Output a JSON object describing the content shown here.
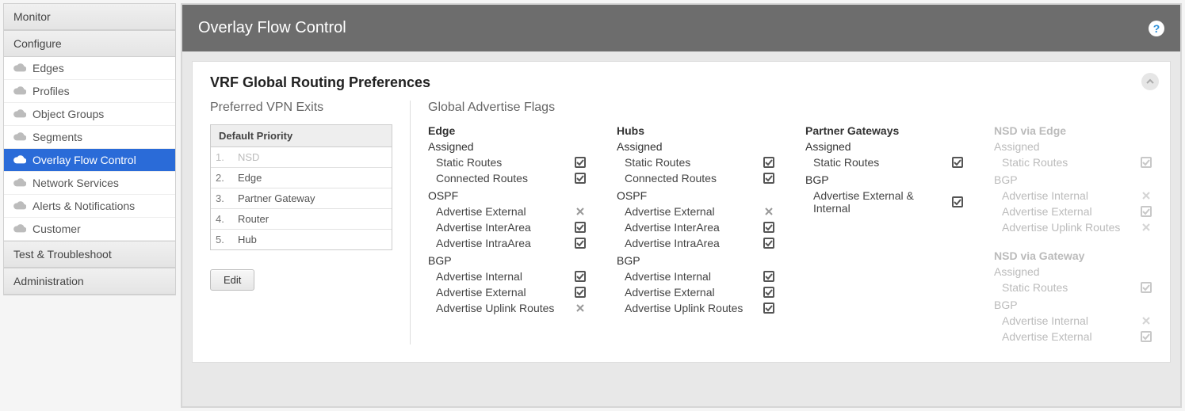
{
  "sidebar": {
    "sections": {
      "monitor": "Monitor",
      "configure": "Configure",
      "test": "Test & Troubleshoot",
      "admin": "Administration"
    },
    "configure_items": [
      {
        "label": "Edges",
        "active": false
      },
      {
        "label": "Profiles",
        "active": false
      },
      {
        "label": "Object Groups",
        "active": false
      },
      {
        "label": "Segments",
        "active": false
      },
      {
        "label": "Overlay Flow Control",
        "active": true
      },
      {
        "label": "Network Services",
        "active": false
      },
      {
        "label": "Alerts & Notifications",
        "active": false
      },
      {
        "label": "Customer",
        "active": false
      }
    ]
  },
  "header": {
    "title": "Overlay Flow Control"
  },
  "panel": {
    "title": "VRF Global Routing Preferences",
    "vpn_exits": {
      "title": "Preferred VPN Exits",
      "table_header": "Default Priority",
      "rows": [
        {
          "num": "1.",
          "name": "NSD",
          "disabled": true
        },
        {
          "num": "2.",
          "name": "Edge",
          "disabled": false
        },
        {
          "num": "3.",
          "name": "Partner Gateway",
          "disabled": false
        },
        {
          "num": "4.",
          "name": "Router",
          "disabled": false
        },
        {
          "num": "5.",
          "name": "Hub",
          "disabled": false
        }
      ]
    },
    "flags": {
      "title": "Global Advertise Flags",
      "columns": [
        {
          "title": "Edge",
          "disabled": false,
          "groups": [
            {
              "label": "Assigned",
              "rows": [
                {
                  "label": "Static Routes",
                  "state": "check"
                },
                {
                  "label": "Connected Routes",
                  "state": "check"
                }
              ]
            },
            {
              "label": "OSPF",
              "rows": [
                {
                  "label": "Advertise External",
                  "state": "x"
                },
                {
                  "label": "Advertise InterArea",
                  "state": "check"
                },
                {
                  "label": "Advertise IntraArea",
                  "state": "check"
                }
              ]
            },
            {
              "label": "BGP",
              "rows": [
                {
                  "label": "Advertise Internal",
                  "state": "check"
                },
                {
                  "label": "Advertise External",
                  "state": "check"
                },
                {
                  "label": "Advertise Uplink Routes",
                  "state": "x"
                }
              ]
            }
          ]
        },
        {
          "title": "Hubs",
          "disabled": false,
          "groups": [
            {
              "label": "Assigned",
              "rows": [
                {
                  "label": "Static Routes",
                  "state": "check"
                },
                {
                  "label": "Connected Routes",
                  "state": "check"
                }
              ]
            },
            {
              "label": "OSPF",
              "rows": [
                {
                  "label": "Advertise External",
                  "state": "x"
                },
                {
                  "label": "Advertise InterArea",
                  "state": "check"
                },
                {
                  "label": "Advertise IntraArea",
                  "state": "check"
                }
              ]
            },
            {
              "label": "BGP",
              "rows": [
                {
                  "label": "Advertise Internal",
                  "state": "check"
                },
                {
                  "label": "Advertise External",
                  "state": "check"
                },
                {
                  "label": "Advertise Uplink Routes",
                  "state": "check"
                }
              ]
            }
          ]
        },
        {
          "title": "Partner Gateways",
          "disabled": false,
          "groups": [
            {
              "label": "Assigned",
              "rows": [
                {
                  "label": "Static Routes",
                  "state": "check"
                }
              ]
            },
            {
              "label": "BGP",
              "rows": [
                {
                  "label": "Advertise External & Internal",
                  "state": "check"
                }
              ]
            }
          ]
        }
      ],
      "nsd_columns": [
        {
          "title": "NSD via Edge",
          "disabled": true,
          "groups": [
            {
              "label": "Assigned",
              "rows": [
                {
                  "label": "Static Routes",
                  "state": "check"
                }
              ]
            },
            {
              "label": "BGP",
              "rows": [
                {
                  "label": "Advertise Internal",
                  "state": "x"
                },
                {
                  "label": "Advertise External",
                  "state": "check"
                },
                {
                  "label": "Advertise Uplink Routes",
                  "state": "x"
                }
              ]
            }
          ]
        },
        {
          "title": "NSD via Gateway",
          "disabled": true,
          "groups": [
            {
              "label": "Assigned",
              "rows": [
                {
                  "label": "Static Routes",
                  "state": "check"
                }
              ]
            },
            {
              "label": "BGP",
              "rows": [
                {
                  "label": "Advertise Internal",
                  "state": "x"
                },
                {
                  "label": "Advertise External",
                  "state": "check"
                }
              ]
            }
          ]
        }
      ]
    },
    "edit_label": "Edit"
  }
}
